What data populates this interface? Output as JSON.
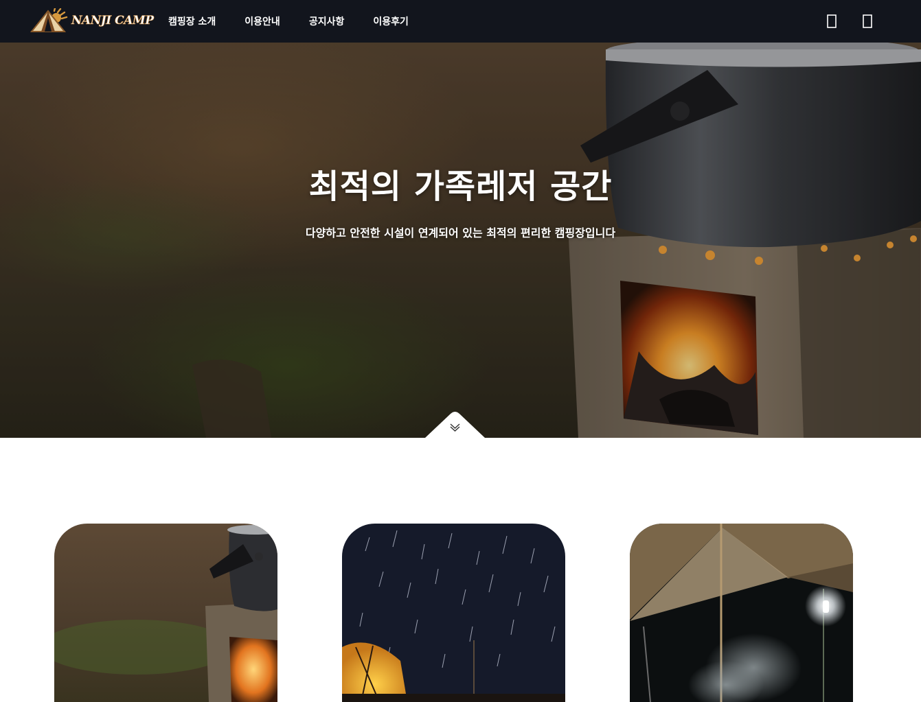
{
  "header": {
    "logo_text": "NANJI CAMP",
    "nav": [
      {
        "label": "캠핑장 소개"
      },
      {
        "label": "이용안내"
      },
      {
        "label": "공지사항"
      },
      {
        "label": "이용후기"
      }
    ],
    "icons": [
      "menu-icon",
      "user-icon"
    ]
  },
  "hero": {
    "title": "최적의 가족레저 공간",
    "subtitle": "다양하고 안전한 시설이 연계되어 있는 최적의 편리한 캠핑장입니다",
    "scroll_icon": "double-chevron-down-icon"
  },
  "cards": [
    {
      "image": "campfire-pot-stove"
    },
    {
      "image": "star-trails-night-tent"
    },
    {
      "image": "tarp-lantern-night"
    }
  ],
  "colors": {
    "header_bg": "#12151d",
    "logo_accent": "#c9873a",
    "text_light": "#ffffff"
  }
}
